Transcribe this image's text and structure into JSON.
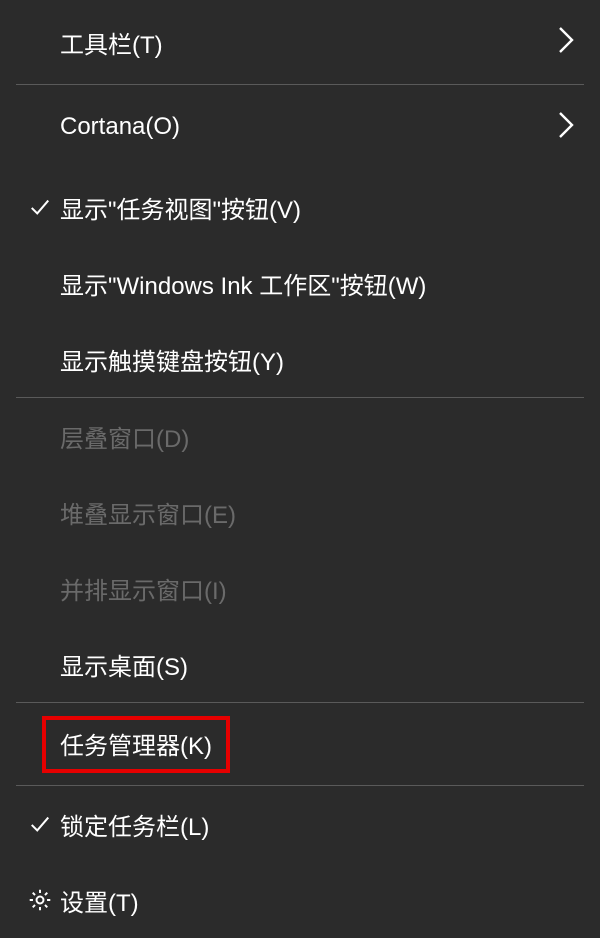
{
  "menu": {
    "items": [
      {
        "label": "工具栏(T)",
        "hasSubmenu": true,
        "checked": false,
        "disabled": false,
        "icon": null
      },
      {
        "label": "Cortana(O)",
        "hasSubmenu": true,
        "checked": false,
        "disabled": false,
        "icon": null
      },
      {
        "label": "显示\"任务视图\"按钮(V)",
        "hasSubmenu": false,
        "checked": true,
        "disabled": false,
        "icon": null
      },
      {
        "label": "显示\"Windows Ink 工作区\"按钮(W)",
        "hasSubmenu": false,
        "checked": false,
        "disabled": false,
        "icon": null
      },
      {
        "label": "显示触摸键盘按钮(Y)",
        "hasSubmenu": false,
        "checked": false,
        "disabled": false,
        "icon": null
      },
      {
        "label": "层叠窗口(D)",
        "hasSubmenu": false,
        "checked": false,
        "disabled": true,
        "icon": null
      },
      {
        "label": "堆叠显示窗口(E)",
        "hasSubmenu": false,
        "checked": false,
        "disabled": true,
        "icon": null
      },
      {
        "label": "并排显示窗口(I)",
        "hasSubmenu": false,
        "checked": false,
        "disabled": true,
        "icon": null
      },
      {
        "label": "显示桌面(S)",
        "hasSubmenu": false,
        "checked": false,
        "disabled": false,
        "icon": null
      },
      {
        "label": "任务管理器(K)",
        "hasSubmenu": false,
        "checked": false,
        "disabled": false,
        "icon": null,
        "highlighted": true
      },
      {
        "label": "锁定任务栏(L)",
        "hasSubmenu": false,
        "checked": true,
        "disabled": false,
        "icon": null
      },
      {
        "label": "设置(T)",
        "hasSubmenu": false,
        "checked": false,
        "disabled": false,
        "icon": "gear"
      }
    ]
  }
}
